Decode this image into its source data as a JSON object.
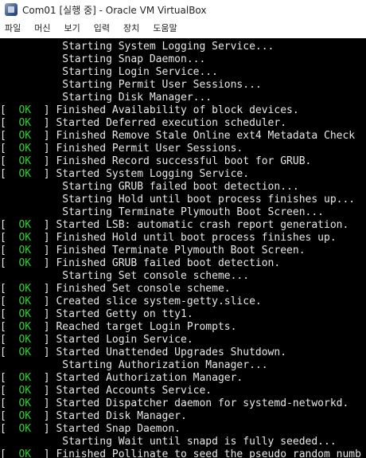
{
  "window": {
    "title": "Com01 [실행 중] - Oracle VM VirtualBox"
  },
  "menu": [
    "파일",
    "머신",
    "보기",
    "입력",
    "장치",
    "도움말"
  ],
  "console": {
    "lines": [
      {
        "status": "",
        "text": "Starting System Logging Service..."
      },
      {
        "status": "",
        "text": "Starting Snap Daemon..."
      },
      {
        "status": "",
        "text": "Starting Login Service..."
      },
      {
        "status": "",
        "text": "Starting Permit User Sessions..."
      },
      {
        "status": "",
        "text": "Starting Disk Manager..."
      },
      {
        "status": "OK",
        "text": "Finished Availability of block devices."
      },
      {
        "status": "OK",
        "text": "Started Deferred execution scheduler."
      },
      {
        "status": "OK",
        "text": "Finished Remove Stale Online ext4 Metadata Check"
      },
      {
        "status": "OK",
        "text": "Finished Permit User Sessions."
      },
      {
        "status": "OK",
        "text": "Finished Record successful boot for GRUB."
      },
      {
        "status": "OK",
        "text": "Started System Logging Service."
      },
      {
        "status": "",
        "text": "Starting GRUB failed boot detection..."
      },
      {
        "status": "",
        "text": "Starting Hold until boot process finishes up..."
      },
      {
        "status": "",
        "text": "Starting Terminate Plymouth Boot Screen..."
      },
      {
        "status": "OK",
        "text": "Started LSB: automatic crash report generation."
      },
      {
        "status": "OK",
        "text": "Finished Hold until boot process finishes up."
      },
      {
        "status": "OK",
        "text": "Finished Terminate Plymouth Boot Screen."
      },
      {
        "status": "OK",
        "text": "Finished GRUB failed boot detection."
      },
      {
        "status": "",
        "text": "Starting Set console scheme..."
      },
      {
        "status": "OK",
        "text": "Finished Set console scheme."
      },
      {
        "status": "OK",
        "text": "Created slice system-getty.slice."
      },
      {
        "status": "OK",
        "text": "Started Getty on tty1."
      },
      {
        "status": "OK",
        "text": "Reached target Login Prompts."
      },
      {
        "status": "OK",
        "text": "Started Login Service."
      },
      {
        "status": "OK",
        "text": "Started Unattended Upgrades Shutdown."
      },
      {
        "status": "",
        "text": "Starting Authorization Manager..."
      },
      {
        "status": "OK",
        "text": "Started Authorization Manager."
      },
      {
        "status": "OK",
        "text": "Started Accounts Service."
      },
      {
        "status": "OK",
        "text": "Started Dispatcher daemon for systemd-networkd."
      },
      {
        "status": "OK",
        "text": "Started Disk Manager."
      },
      {
        "status": "OK",
        "text": "Started Snap Daemon."
      },
      {
        "status": "",
        "text": "Starting Wait until snapd is fully seeded..."
      },
      {
        "status": "OK",
        "text": "Finished Pollinate to seed the pseudo random numb"
      }
    ]
  },
  "colors": {
    "ok": "#2fd02f",
    "text": "#e8e8e8",
    "screen_bg": "#000000"
  },
  "icons": {
    "app": "virtualbox-icon"
  }
}
